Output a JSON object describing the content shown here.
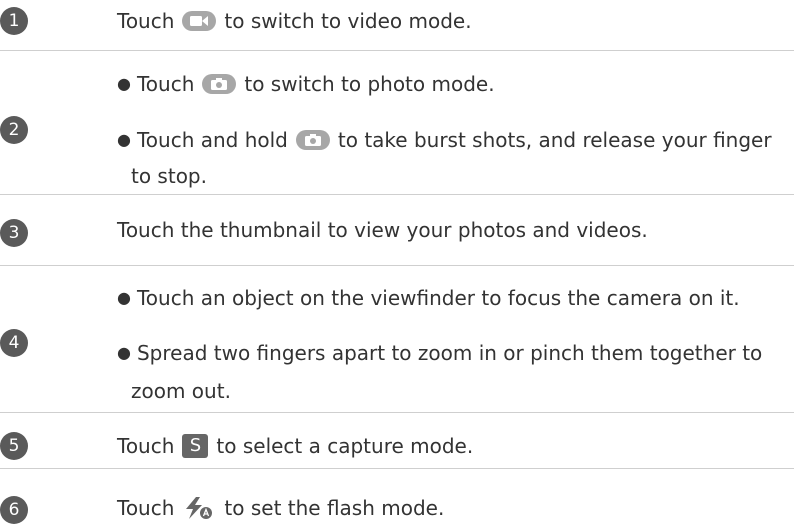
{
  "rows": [
    {
      "num": "1",
      "text_before": "Touch",
      "text_after": "to switch to video mode.",
      "icon": "video-camera-icon"
    },
    {
      "num": "2",
      "bullet1_before": "Touch",
      "bullet1_after": "to switch to photo mode.",
      "icon1": "photo-camera-icon",
      "bullet2_before": "Touch and hold",
      "bullet2_after": "to take burst shots, and release your finger",
      "bullet2_cont": "to stop.",
      "icon2": "photo-camera-icon"
    },
    {
      "num": "3",
      "text": "Touch the thumbnail to view your photos and videos."
    },
    {
      "num": "4",
      "bullet1": "Touch an object on the viewfinder to focus the camera on it.",
      "bullet2": "Spread two fingers apart to zoom in or pinch them together to",
      "bullet2_cont": "zoom out."
    },
    {
      "num": "5",
      "text_before": "Touch",
      "text_after": "to select a capture mode.",
      "icon": "capture-mode-icon",
      "icon_letter": "S"
    },
    {
      "num": "6",
      "text_before": "Touch",
      "text_after": "to set the flash mode.",
      "icon": "flash-auto-icon"
    }
  ],
  "colors": {
    "icon_gray": "#a7a7a7",
    "badge": "#5a5a5a",
    "divider": "#cfcfcf"
  }
}
